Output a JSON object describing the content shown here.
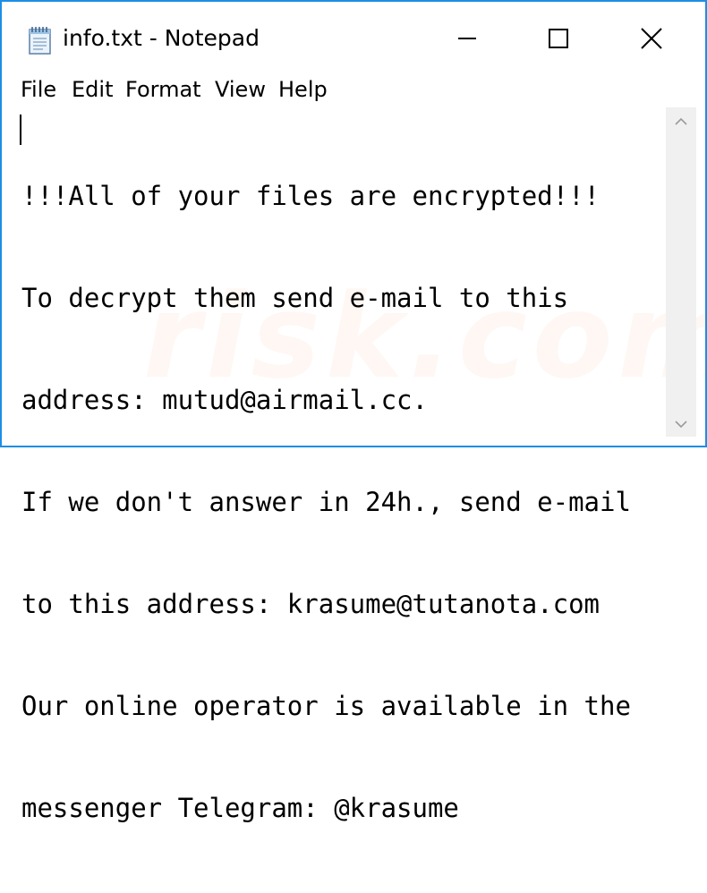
{
  "window": {
    "title": "info.txt - Notepad",
    "controls": {
      "minimize": "minimize-icon",
      "maximize": "maximize-icon",
      "close": "close-icon"
    },
    "accent_color": "#1c8ee6"
  },
  "menu": {
    "items": [
      "File",
      "Edit",
      "Format",
      "View",
      "Help"
    ]
  },
  "editor": {
    "lines": [
      "!!!All of your files are encrypted!!!",
      "To decrypt them send e-mail to this",
      "address: mutud@airmail.cc.",
      "If we don't answer in 24h., send e-mail",
      "to this address: krasume@tutanota.com",
      "Our online operator is available in the",
      "messenger Telegram: @krasume"
    ]
  },
  "watermark": {
    "text": "risk.com"
  }
}
